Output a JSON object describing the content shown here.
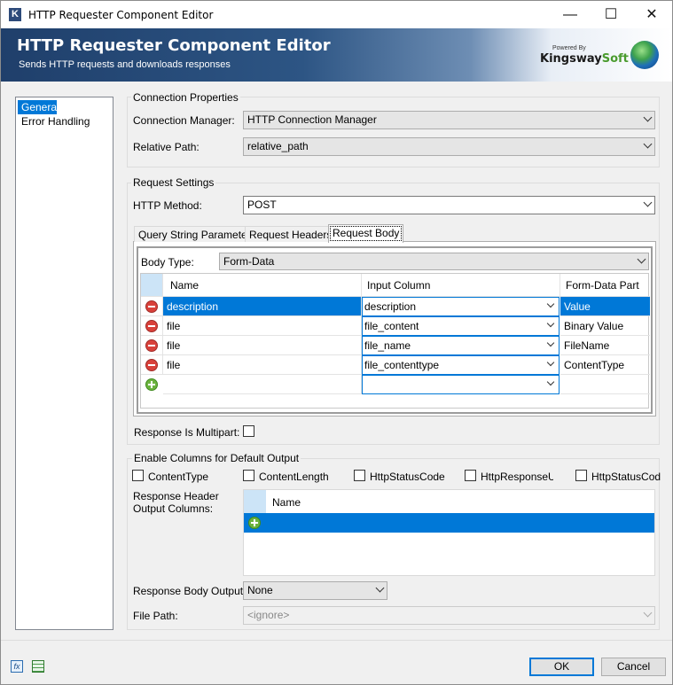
{
  "window": {
    "title": "HTTP Requester Component Editor",
    "app_icon": "K",
    "minimize": "—",
    "maximize": "☐",
    "close": "✕"
  },
  "header": {
    "title": "HTTP Requester Component Editor",
    "subtitle": "Sends HTTP requests and downloads responses",
    "brand_powered": "Powered By",
    "brand_name_k": "K",
    "brand_name_rest": "ingsway",
    "brand_soft": "Soft"
  },
  "sidebar": {
    "items": [
      "General",
      "Error Handling"
    ]
  },
  "connection": {
    "group_label": "Connection Properties",
    "manager_label": "Connection Manager:",
    "manager_value": "HTTP Connection Manager",
    "path_label": "Relative Path:",
    "path_value": "relative_path"
  },
  "request": {
    "group_label": "Request Settings",
    "method_label": "HTTP Method:",
    "method_value": "POST",
    "tabs": [
      "Query String Parameters",
      "Request Headers",
      "Request Body"
    ],
    "body_type_label": "Body Type:",
    "body_type_value": "Form-Data",
    "columns": [
      "Name",
      "Input Column",
      "Form-Data Part"
    ],
    "rows": [
      {
        "name": "description",
        "input": "description",
        "part": "Value"
      },
      {
        "name": "file",
        "input": "file_content",
        "part": "Binary Value"
      },
      {
        "name": "file",
        "input": "file_name",
        "part": "FileName"
      },
      {
        "name": "file",
        "input": "file_contenttype",
        "part": "ContentType"
      }
    ],
    "multipart_label": "Response Is Multipart:"
  },
  "output": {
    "group_label": "Enable Columns for Default Output",
    "checkboxes": [
      "ContentType",
      "ContentLength",
      "HttpStatusCode",
      "HttpResponseUrl",
      "HttpStatusCodeI"
    ],
    "header_cols_label_1": "Response Header",
    "header_cols_label_2": "Output Columns:",
    "header_cols_column": "Name",
    "body_output_label": "Response Body Output:",
    "body_output_value": "None",
    "file_path_label": "File Path:",
    "file_path_value": "<ignore>"
  },
  "footer": {
    "ok": "OK",
    "cancel": "Cancel",
    "fx_icon": "fx"
  },
  "colors": {
    "selection": "#0078d7",
    "header_dark": "#1f3f6b"
  }
}
